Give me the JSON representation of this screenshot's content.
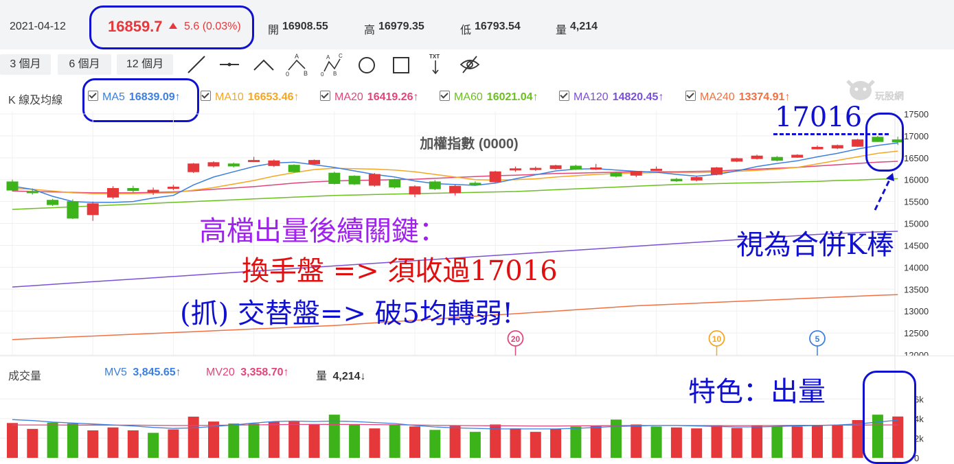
{
  "header": {
    "date": "2021-04-12",
    "price": "16859.7",
    "change": "5.6 (0.03%)",
    "open_label": "開",
    "open_value": "16908.55",
    "high_label": "高",
    "high_value": "16979.35",
    "low_label": "低",
    "low_value": "16793.54",
    "vol_label": "量",
    "vol_value": "4,214",
    "colors": {
      "up": "#e5383b",
      "down": "#3db31a"
    }
  },
  "toolbar": {
    "periods": [
      "3 個月",
      "6 個月",
      "12 個月"
    ],
    "tools": [
      "line-tool-icon",
      "horizontal-line-tool-icon",
      "angle-tool-icon",
      "abc-pattern-tool-icon",
      "abcd-pattern-tool-icon",
      "circle-tool-icon",
      "rectangle-tool-icon",
      "text-tool-icon",
      "hide-drawings-icon"
    ],
    "txt_label": "TXT",
    "abc_labels": [
      "0",
      "A",
      "B"
    ],
    "abcd_labels": [
      "0",
      "A",
      "B",
      "C"
    ]
  },
  "ma_row": {
    "label": "K 線及均線",
    "items": [
      {
        "name": "MA5",
        "value": "16839.09",
        "arrow": "↑",
        "color": "#3b7fe0"
      },
      {
        "name": "MA10",
        "value": "16653.46",
        "arrow": "↑",
        "color": "#f5a623"
      },
      {
        "name": "MA20",
        "value": "16419.26",
        "arrow": "↑",
        "color": "#e0457b"
      },
      {
        "name": "MA60",
        "value": "16021.04",
        "arrow": "↑",
        "color": "#6bbf1f"
      },
      {
        "name": "MA120",
        "value": "14820.45",
        "arrow": "↑",
        "color": "#7b4fd6"
      },
      {
        "name": "MA240",
        "value": "13374.91",
        "arrow": "↑",
        "color": "#f07040"
      }
    ]
  },
  "watermark": "玩股網",
  "chart_data": [
    {
      "type": "candlestick",
      "title": "加權指數 (0000)",
      "ylim": [
        12000,
        17500
      ],
      "yticks": [
        12000,
        12500,
        13000,
        13500,
        14000,
        14500,
        15000,
        15500,
        16000,
        16500,
        17000,
        17500
      ],
      "candles": [
        {
          "o": 15950,
          "c": 15760,
          "h": 16000,
          "l": 15730
        },
        {
          "o": 15730,
          "c": 15700,
          "h": 15800,
          "l": 15660
        },
        {
          "o": 15530,
          "c": 15430,
          "h": 15560,
          "l": 15400
        },
        {
          "o": 15500,
          "c": 15120,
          "h": 15550,
          "l": 15100
        },
        {
          "o": 15200,
          "c": 15450,
          "h": 15500,
          "l": 15060
        },
        {
          "o": 15600,
          "c": 15800,
          "h": 15850,
          "l": 15560
        },
        {
          "o": 15800,
          "c": 15750,
          "h": 15860,
          "l": 15700
        },
        {
          "o": 15710,
          "c": 15760,
          "h": 15820,
          "l": 15650
        },
        {
          "o": 15800,
          "c": 15830,
          "h": 15880,
          "l": 15760
        },
        {
          "o": 16180,
          "c": 16360,
          "h": 16380,
          "l": 16150
        },
        {
          "o": 16310,
          "c": 16390,
          "h": 16420,
          "l": 16280
        },
        {
          "o": 16360,
          "c": 16310,
          "h": 16390,
          "l": 16280
        },
        {
          "o": 16430,
          "c": 16440,
          "h": 16520,
          "l": 16400
        },
        {
          "o": 16320,
          "c": 16430,
          "h": 16460,
          "l": 16290
        },
        {
          "o": 16330,
          "c": 16180,
          "h": 16350,
          "l": 16160
        },
        {
          "o": 16360,
          "c": 16440,
          "h": 16460,
          "l": 16330
        },
        {
          "o": 16150,
          "c": 15910,
          "h": 16180,
          "l": 15890
        },
        {
          "o": 16080,
          "c": 15900,
          "h": 16100,
          "l": 15880
        },
        {
          "o": 15870,
          "c": 16120,
          "h": 16150,
          "l": 15840
        },
        {
          "o": 16000,
          "c": 15830,
          "h": 16020,
          "l": 15800
        },
        {
          "o": 15670,
          "c": 15840,
          "h": 15870,
          "l": 15600
        },
        {
          "o": 15950,
          "c": 15790,
          "h": 15990,
          "l": 15760
        },
        {
          "o": 15700,
          "c": 15850,
          "h": 15880,
          "l": 15640
        },
        {
          "o": 15920,
          "c": 15880,
          "h": 15960,
          "l": 15860
        },
        {
          "o": 15950,
          "c": 16180,
          "h": 16200,
          "l": 15920
        },
        {
          "o": 16220,
          "c": 16250,
          "h": 16300,
          "l": 16180
        },
        {
          "o": 16240,
          "c": 16260,
          "h": 16300,
          "l": 16200
        },
        {
          "o": 16250,
          "c": 16320,
          "h": 16340,
          "l": 16230
        },
        {
          "o": 16310,
          "c": 16240,
          "h": 16340,
          "l": 16220
        },
        {
          "o": 16240,
          "c": 16270,
          "h": 16360,
          "l": 16220
        },
        {
          "o": 16150,
          "c": 16080,
          "h": 16180,
          "l": 16050
        },
        {
          "o": 16100,
          "c": 16190,
          "h": 16200,
          "l": 16060
        },
        {
          "o": 16210,
          "c": 16240,
          "h": 16300,
          "l": 16200
        },
        {
          "o": 16010,
          "c": 15970,
          "h": 16040,
          "l": 15950
        },
        {
          "o": 15990,
          "c": 16050,
          "h": 16080,
          "l": 15960
        },
        {
          "o": 16120,
          "c": 16270,
          "h": 16290,
          "l": 16100
        },
        {
          "o": 16420,
          "c": 16480,
          "h": 16500,
          "l": 16400
        },
        {
          "o": 16480,
          "c": 16540,
          "h": 16570,
          "l": 16460
        },
        {
          "o": 16510,
          "c": 16440,
          "h": 16540,
          "l": 16420
        },
        {
          "o": 16510,
          "c": 16560,
          "h": 16580,
          "l": 16500
        },
        {
          "o": 16700,
          "c": 16740,
          "h": 16780,
          "l": 16690
        },
        {
          "o": 16720,
          "c": 16780,
          "h": 16800,
          "l": 16700
        },
        {
          "o": 16760,
          "c": 16910,
          "h": 16930,
          "l": 16750
        },
        {
          "o": 16970,
          "c": 16870,
          "h": 17000,
          "l": 16860
        },
        {
          "o": 16910,
          "c": 16860,
          "h": 16980,
          "l": 16790
        }
      ],
      "ma5": [
        15850,
        15780,
        15620,
        15500,
        15480,
        15480,
        15500,
        15580,
        15640,
        15880,
        16060,
        16180,
        16300,
        16380,
        16400,
        16340,
        16280,
        16200,
        16120,
        16060,
        15970,
        15910,
        15890,
        15870,
        15920,
        16020,
        16110,
        16200,
        16240,
        16250,
        16220,
        16190,
        16170,
        16120,
        16080,
        16120,
        16200,
        16300,
        16370,
        16430,
        16520,
        16600,
        16700,
        16780,
        16839
      ],
      "ma10": [
        15800,
        15780,
        15740,
        15700,
        15680,
        15680,
        15680,
        15690,
        15700,
        15760,
        15820,
        15900,
        15980,
        16080,
        16160,
        16230,
        16260,
        16250,
        16240,
        16220,
        16180,
        16120,
        16060,
        16000,
        15990,
        16000,
        16020,
        16060,
        16090,
        16120,
        16140,
        16150,
        16160,
        16160,
        16160,
        16170,
        16190,
        16210,
        16240,
        16280,
        16360,
        16440,
        16520,
        16600,
        16653
      ],
      "ma20": [
        15740,
        15730,
        15720,
        15710,
        15700,
        15700,
        15700,
        15710,
        15720,
        15750,
        15780,
        15810,
        15840,
        15880,
        15920,
        15950,
        15970,
        15980,
        15990,
        16000,
        16010,
        16030,
        16050,
        16070,
        16090,
        16100,
        16120,
        16140,
        16150,
        16160,
        16170,
        16180,
        16180,
        16180,
        16190,
        16200,
        16220,
        16240,
        16260,
        16280,
        16310,
        16340,
        16370,
        16400,
        16419
      ],
      "ma60": [
        15320,
        15340,
        15360,
        15380,
        15400,
        15420,
        15440,
        15460,
        15480,
        15500,
        15520,
        15540,
        15560,
        15580,
        15600,
        15620,
        15640,
        15650,
        15660,
        15670,
        15680,
        15690,
        15700,
        15710,
        15720,
        15730,
        15750,
        15770,
        15790,
        15810,
        15830,
        15850,
        15870,
        15890,
        15900,
        15910,
        15920,
        15930,
        15940,
        15950,
        15960,
        15980,
        15990,
        16010,
        16021
      ],
      "ma120": [
        13550,
        13580,
        13610,
        13640,
        13670,
        13700,
        13730,
        13760,
        13790,
        13820,
        13850,
        13880,
        13910,
        13940,
        13970,
        14000,
        14030,
        14060,
        14090,
        14120,
        14150,
        14180,
        14210,
        14240,
        14270,
        14300,
        14330,
        14360,
        14390,
        14420,
        14450,
        14480,
        14510,
        14540,
        14570,
        14600,
        14630,
        14660,
        14690,
        14720,
        14750,
        14770,
        14790,
        14810,
        14820
      ],
      "ma240": [
        12350,
        12370,
        12390,
        12410,
        12430,
        12450,
        12470,
        12490,
        12510,
        12530,
        12550,
        12570,
        12590,
        12610,
        12630,
        12650,
        12670,
        12700,
        12730,
        12760,
        12790,
        12820,
        12850,
        12880,
        12910,
        12940,
        12970,
        13000,
        13030,
        13060,
        13090,
        13120,
        13140,
        13160,
        13180,
        13200,
        13220,
        13240,
        13260,
        13280,
        13300,
        13320,
        13340,
        13360,
        13375
      ],
      "markers": [
        {
          "label": "20",
          "index": 25
        },
        {
          "label": "10",
          "index": 35
        },
        {
          "label": "5",
          "index": 40
        }
      ]
    },
    {
      "type": "bar",
      "title": "成交量",
      "ylim": [
        0,
        7000
      ],
      "ytick_labels": [
        "0",
        "2k",
        "4k",
        "6k"
      ],
      "legend": [
        {
          "name": "MV5",
          "value": "3,845.65",
          "arrow": "↑",
          "color": "#3b7fe0"
        },
        {
          "name": "MV20",
          "value": "3,358.70",
          "arrow": "↑",
          "color": "#e0457b"
        },
        {
          "name": "量",
          "value": "4,214",
          "arrow": "↓",
          "color": "#333333"
        }
      ],
      "volumes": [
        3550,
        2950,
        3600,
        3500,
        2800,
        3100,
        2800,
        2550,
        2900,
        4200,
        3700,
        3500,
        3500,
        3700,
        3700,
        3450,
        4400,
        3400,
        3000,
        3350,
        3200,
        2850,
        3250,
        2650,
        3400,
        3000,
        2650,
        2950,
        3200,
        3250,
        3900,
        3400,
        3200,
        3100,
        3000,
        3300,
        3050,
        3300,
        3200,
        3200,
        3300,
        3300,
        3850,
        4400,
        4214
      ],
      "colors": [
        "up",
        "up",
        "down",
        "down",
        "up",
        "up",
        "up",
        "down",
        "up",
        "up",
        "up",
        "down",
        "down",
        "up",
        "up",
        "up",
        "down",
        "down",
        "up",
        "down",
        "up",
        "down",
        "up",
        "down",
        "up",
        "up",
        "up",
        "up",
        "down",
        "up",
        "down",
        "up",
        "down",
        "up",
        "up",
        "up",
        "up",
        "up",
        "down",
        "up",
        "up",
        "up",
        "up",
        "down",
        "up"
      ],
      "mv5": [
        3900,
        3800,
        3650,
        3550,
        3450,
        3350,
        3250,
        3100,
        3000,
        3050,
        3200,
        3350,
        3550,
        3700,
        3750,
        3700,
        3750,
        3700,
        3600,
        3500,
        3300,
        3150,
        3050,
        3000,
        2950,
        2950,
        2950,
        2950,
        3000,
        3100,
        3200,
        3250,
        3300,
        3300,
        3250,
        3200,
        3150,
        3150,
        3200,
        3250,
        3300,
        3350,
        3450,
        3650,
        3846
      ],
      "mv20": [
        3350,
        3350,
        3350,
        3340,
        3340,
        3330,
        3330,
        3320,
        3300,
        3300,
        3320,
        3340,
        3360,
        3380,
        3400,
        3400,
        3410,
        3400,
        3390,
        3370,
        3350,
        3320,
        3300,
        3280,
        3270,
        3260,
        3250,
        3250,
        3260,
        3270,
        3290,
        3300,
        3300,
        3300,
        3290,
        3290,
        3280,
        3290,
        3300,
        3310,
        3320,
        3330,
        3340,
        3350,
        3359
      ]
    }
  ],
  "annotations": {
    "level": "17016",
    "merge_note": "視為合併K棒",
    "line1": "高檔出量後續關鍵：",
    "line2": "換手盤 => 須收過17016",
    "line3": "(抓) 交替盤=> 破5均轉弱!",
    "feature": "特色：出量"
  }
}
